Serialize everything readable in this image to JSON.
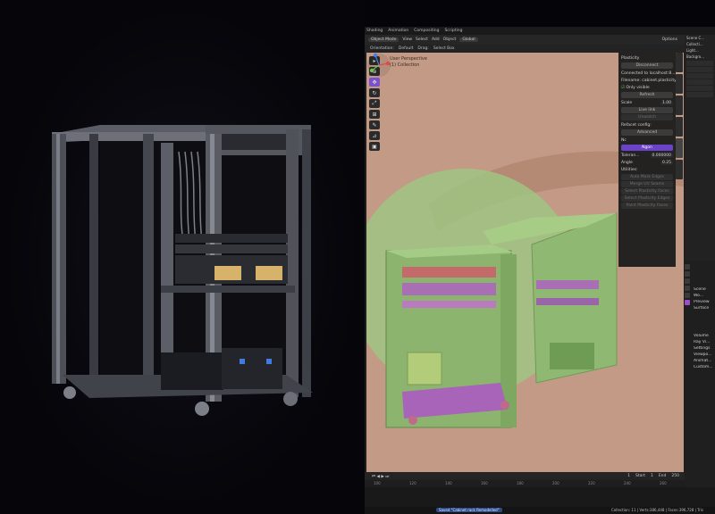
{
  "topbar": {
    "tabs": [
      "Shading",
      "Animation",
      "Compositing",
      "Scripting"
    ]
  },
  "header": {
    "mode": "Object Mode",
    "menus": [
      "View",
      "Select",
      "Add",
      "Object"
    ],
    "transform": "Global",
    "options": "Options"
  },
  "subheader": {
    "orientation": "Orientation:",
    "default": "Default",
    "drag": "Drag:",
    "select_box": "Select Box"
  },
  "plasticity": {
    "title": "Plasticity",
    "disconnect": "Disconnect",
    "connected": "Connected to localhost:8...",
    "filename": "Filename: cabinet.plasticity",
    "only_visible": "Only visible",
    "refresh": "Refresh",
    "scale_label": "Scale",
    "scale_value": "1.00",
    "live_link": "Live link",
    "unwatch": "Unwatch",
    "refacet_config": "Refacet config:",
    "advanced": "Advanced",
    "nc": "Nc",
    "ngon": "Ngon",
    "tolerance_label": "Toleran...",
    "tolerance_value": "0.000000",
    "angle_label": "Angle",
    "angle_value": "0.25",
    "utilities": "Utilities:",
    "auto_mark_edges": "Auto Mark Edges",
    "merge_uv_seams": "Merge UV Seams",
    "select_plasticity_faces": "Select Plasticity Faces",
    "select_plasticity_edges": "Select Plasticity Edges",
    "paint_plasticity_faces": "Paint Plasticity Faces"
  },
  "viewport": {
    "label_top": "User Perspective",
    "label_sub": "(1) Collection"
  },
  "outliner": {
    "items": [
      "Scene C...",
      "Collecti...",
      "Light...",
      "Backgro..."
    ]
  },
  "properties": {
    "items": [
      "Scene",
      "Wo...",
      "Preview",
      "Surface",
      "Volume",
      "Ray Vi...",
      "Settings",
      "Viewpo...",
      "Animat...",
      "Custom..."
    ]
  },
  "timeline": {
    "frame_current": "1",
    "start_label": "Start",
    "start_value": "1",
    "end_label": "End",
    "end_value": "250",
    "ruler": [
      "100",
      "120",
      "140",
      "160",
      "180",
      "200",
      "220",
      "240",
      "260"
    ]
  },
  "status": {
    "saved": "Saved \"Cabinet rack Remodelled\"",
    "stats": "Collection: 11 | Verts:386,448 | Faces:396,728 | Tris"
  },
  "colors": {
    "viewport_bg": "#c29a86",
    "green_mesh": "#9fc482",
    "purple_accent": "#7b4fd0",
    "panel_bg": "#1e1e1e"
  }
}
